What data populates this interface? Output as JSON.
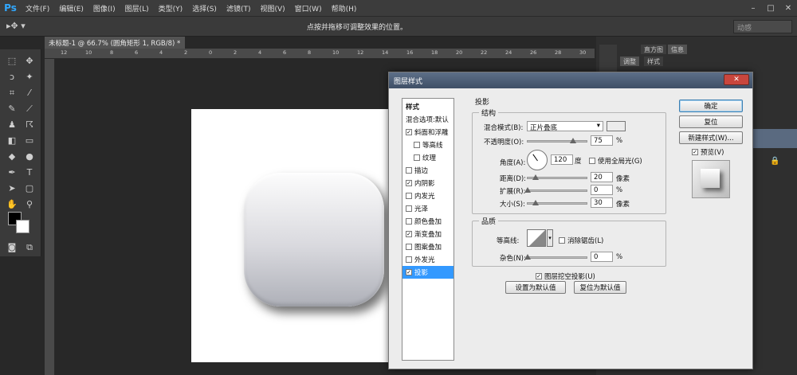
{
  "menubar": {
    "logo": "Ps",
    "items": [
      "文件(F)",
      "编辑(E)",
      "图像(I)",
      "图层(L)",
      "类型(Y)",
      "选择(S)",
      "滤镜(T)",
      "视图(V)",
      "窗口(W)",
      "帮助(H)"
    ],
    "window_controls": [
      "–",
      "□",
      "✕"
    ]
  },
  "options_bar": {
    "tool_glyph": "▸✥ ▾",
    "hint": "点按并拖移可调整效果的位置。",
    "workspace": "动感"
  },
  "document": {
    "tab_title": "未标题-1 @ 66.7% (圆角矩形 1, RGB/8) *",
    "ruler_numbers": [
      "12",
      "10",
      "8",
      "6",
      "4",
      "2",
      "0",
      "2",
      "4",
      "6",
      "8",
      "10",
      "12",
      "14",
      "16",
      "18",
      "20",
      "22",
      "24",
      "26",
      "28",
      "30"
    ]
  },
  "panels": {
    "tabs_top": [
      "直方图",
      "信息"
    ],
    "tabs_mid": [
      "调整",
      "样式"
    ]
  },
  "dialog": {
    "title": "图层样式",
    "close": "✕",
    "style_list_header": "样式",
    "style_list": [
      {
        "label": "混合选项:默认",
        "checkbox": false,
        "checked": false,
        "indent": false,
        "selected": false
      },
      {
        "label": "斜面和浮雕",
        "checkbox": true,
        "checked": true,
        "indent": false,
        "selected": false
      },
      {
        "label": "等高线",
        "checkbox": true,
        "checked": false,
        "indent": true,
        "selected": false
      },
      {
        "label": "纹理",
        "checkbox": true,
        "checked": false,
        "indent": true,
        "selected": false
      },
      {
        "label": "描边",
        "checkbox": true,
        "checked": false,
        "indent": false,
        "selected": false
      },
      {
        "label": "内阴影",
        "checkbox": true,
        "checked": true,
        "indent": false,
        "selected": false
      },
      {
        "label": "内发光",
        "checkbox": true,
        "checked": false,
        "indent": false,
        "selected": false
      },
      {
        "label": "光泽",
        "checkbox": true,
        "checked": false,
        "indent": false,
        "selected": false
      },
      {
        "label": "颜色叠加",
        "checkbox": true,
        "checked": false,
        "indent": false,
        "selected": false
      },
      {
        "label": "渐变叠加",
        "checkbox": true,
        "checked": true,
        "indent": false,
        "selected": false
      },
      {
        "label": "图案叠加",
        "checkbox": true,
        "checked": false,
        "indent": false,
        "selected": false
      },
      {
        "label": "外发光",
        "checkbox": true,
        "checked": false,
        "indent": false,
        "selected": false
      },
      {
        "label": "投影",
        "checkbox": true,
        "checked": true,
        "indent": false,
        "selected": true
      }
    ],
    "section_title": "投影",
    "structure": {
      "title": "结构",
      "blend_mode_label": "混合模式(B):",
      "blend_mode_value": "正片叠底",
      "opacity_label": "不透明度(O):",
      "opacity_value": "75",
      "opacity_unit": "%",
      "opacity_fraction": 0.75,
      "angle_label": "角度(A):",
      "angle_value": "120",
      "angle_unit": "度",
      "global_light_label": "使用全局光(G)",
      "global_light_checked": false,
      "distance_label": "距离(D):",
      "distance_value": "20",
      "distance_unit": "像素",
      "spread_label": "扩展(R):",
      "spread_value": "0",
      "spread_unit": "%",
      "size_label": "大小(S):",
      "size_value": "30",
      "size_unit": "像素",
      "shadow_color": "#000000"
    },
    "quality": {
      "title": "品质",
      "contour_label": "等高线:",
      "antialias_label": "消除锯齿(L)",
      "antialias_checked": false,
      "noise_label": "杂色(N):",
      "noise_value": "0",
      "noise_unit": "%"
    },
    "knockout_label": "图层挖空投影(U)",
    "knockout_checked": true,
    "set_default": "设置为默认值",
    "reset_default": "复位为默认值",
    "buttons": {
      "ok": "确定",
      "reset": "复位",
      "new_style": "新建样式(W)...",
      "preview_label": "预览(V)",
      "preview_checked": true
    }
  }
}
